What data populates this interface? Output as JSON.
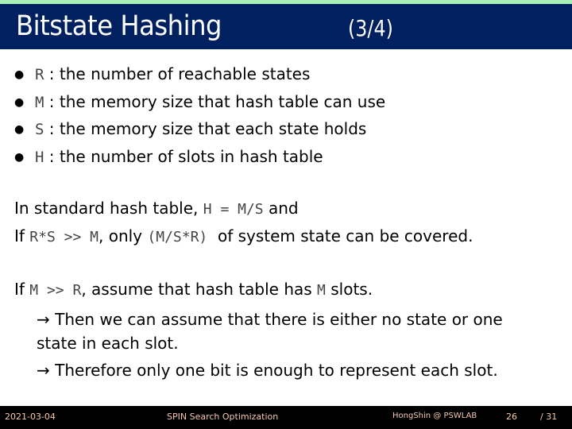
{
  "slide": {
    "title": "Bitstate Hashing",
    "page_indicator": "(3/4)",
    "colors": {
      "title_bar": "#002060",
      "top_strip": "#a8f0b8",
      "footer_bg": "#000000",
      "footer_text": "#f4c8b0"
    }
  },
  "bullets": [
    {
      "symbol": "R",
      "sep": " : ",
      "text": "the number of reachable states"
    },
    {
      "symbol": "M",
      "sep": " : ",
      "text": "the memory size that hash table can use"
    },
    {
      "symbol": "S",
      "sep": " : ",
      "text": "the memory size that each state holds"
    },
    {
      "symbol": "H",
      "sep": " : ",
      "text": "the number of slots in hash table"
    }
  ],
  "para1": {
    "line1_a": "In standard hash table, ",
    "line1_code": "H = M/S",
    "line1_b": " and",
    "line2_a": "If ",
    "line2_code1": "R*S >> M",
    "line2_b": ", only ",
    "line2_code2": "(M/S*R)",
    "line2_c": "  of system state can be covered."
  },
  "para2": {
    "line1_a": "If ",
    "line1_code1": "M >> R",
    "line1_b": ", assume that hash table has ",
    "line1_code2": "M",
    "line1_c": " slots.",
    "arrow1_line1": "→ Then we can assume that there is either no state or one",
    "arrow1_line2": "state in each slot.",
    "arrow2": "→ Therefore only one bit is enough to represent each slot."
  },
  "footer": {
    "date": "2021-03-04",
    "topic": "SPIN Search Optimization",
    "author": "HongShin @ PSWLAB",
    "page": "26",
    "total": "/ 31"
  }
}
